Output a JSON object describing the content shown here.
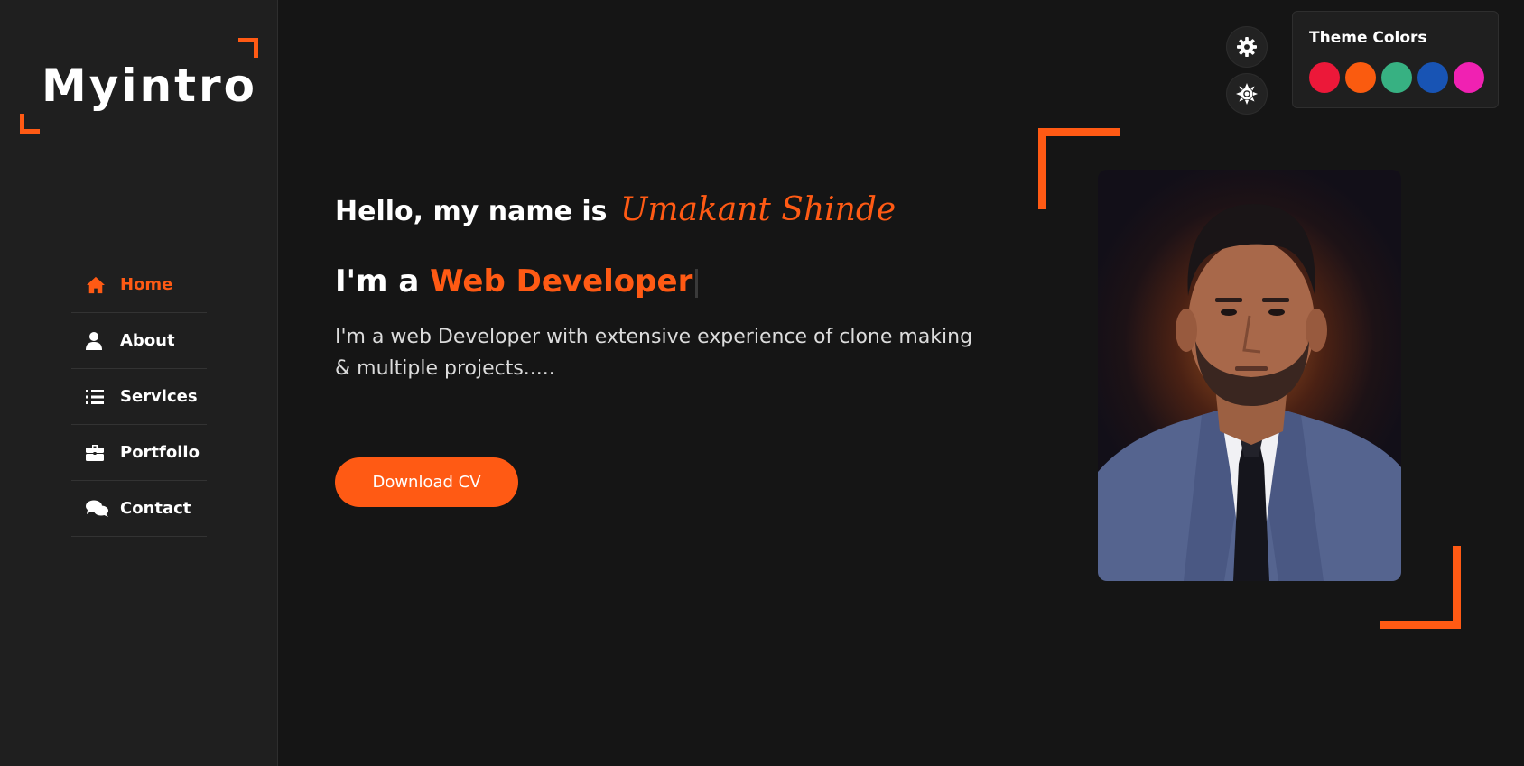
{
  "logo": {
    "text": "Myintro"
  },
  "nav": {
    "items": [
      {
        "label": "Home",
        "icon": "home-icon",
        "active": true
      },
      {
        "label": "About",
        "icon": "user-icon",
        "active": false
      },
      {
        "label": "Services",
        "icon": "list-icon",
        "active": false
      },
      {
        "label": "Portfolio",
        "icon": "briefcase-icon",
        "active": false
      },
      {
        "label": "Contact",
        "icon": "comments-icon",
        "active": false
      }
    ]
  },
  "home": {
    "greeting_prefix": "Hello, my name is",
    "name": "Umakant Shinde",
    "role_prefix": "I'm a",
    "role": "Web Developer",
    "intro": "I'm a web Developer with extensive experience of clone making & multiple projects.....",
    "cta_label": "Download CV"
  },
  "theme": {
    "title": "Theme Colors",
    "colors": [
      "#ec1839",
      "#fa5b0f",
      "#37b182",
      "#1854b4",
      "#f021b2"
    ]
  },
  "colors": {
    "accent": "#ff5a14",
    "background": "#151515",
    "sidebar": "#1f1f1f"
  }
}
